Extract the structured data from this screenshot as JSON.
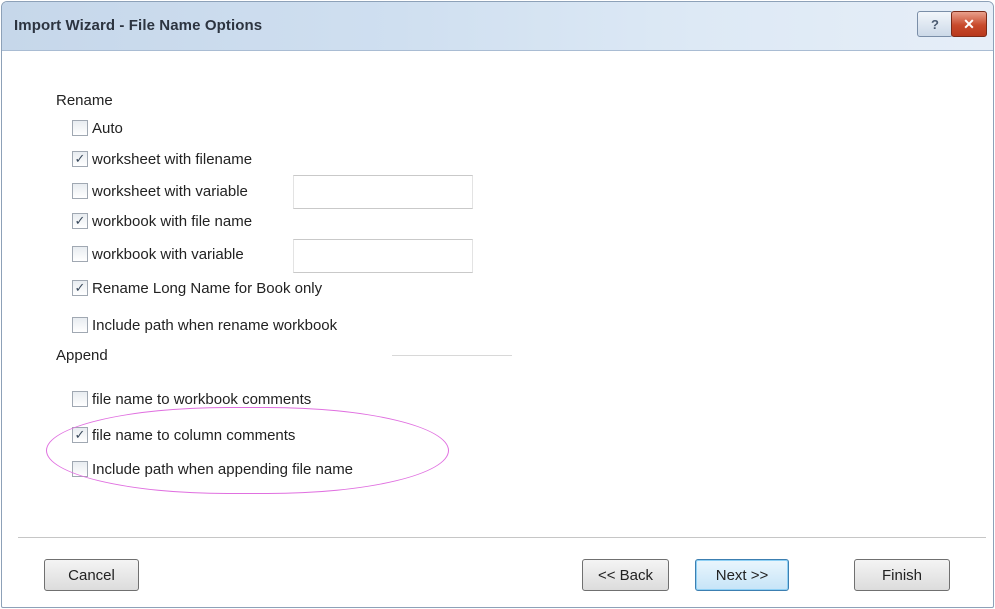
{
  "window": {
    "title": "Import Wizard - File Name Options",
    "help_label": "?",
    "close_label": "✕"
  },
  "rename": {
    "label": "Rename",
    "options": [
      {
        "label": "Auto",
        "checked": false
      },
      {
        "label": "worksheet with filename",
        "checked": true
      },
      {
        "label": "worksheet with variable",
        "checked": false,
        "input_value": ""
      },
      {
        "label": "workbook with file name",
        "checked": true
      },
      {
        "label": "workbook with variable",
        "checked": false,
        "input_value": ""
      },
      {
        "label": "Rename Long Name for Book only",
        "checked": true
      },
      {
        "label": "Include path when rename workbook",
        "checked": false
      }
    ]
  },
  "append": {
    "label": "Append",
    "options": [
      {
        "label": "file name to workbook comments",
        "checked": false
      },
      {
        "label": "file name to column comments",
        "checked": true
      },
      {
        "label": "Include path when appending file name",
        "checked": false
      }
    ]
  },
  "buttons": {
    "cancel": "Cancel",
    "back": "<< Back",
    "next": "Next >>",
    "finish": "Finish"
  },
  "colors": {
    "highlight": "#e070e0",
    "titlebar": "#cfdff0"
  }
}
